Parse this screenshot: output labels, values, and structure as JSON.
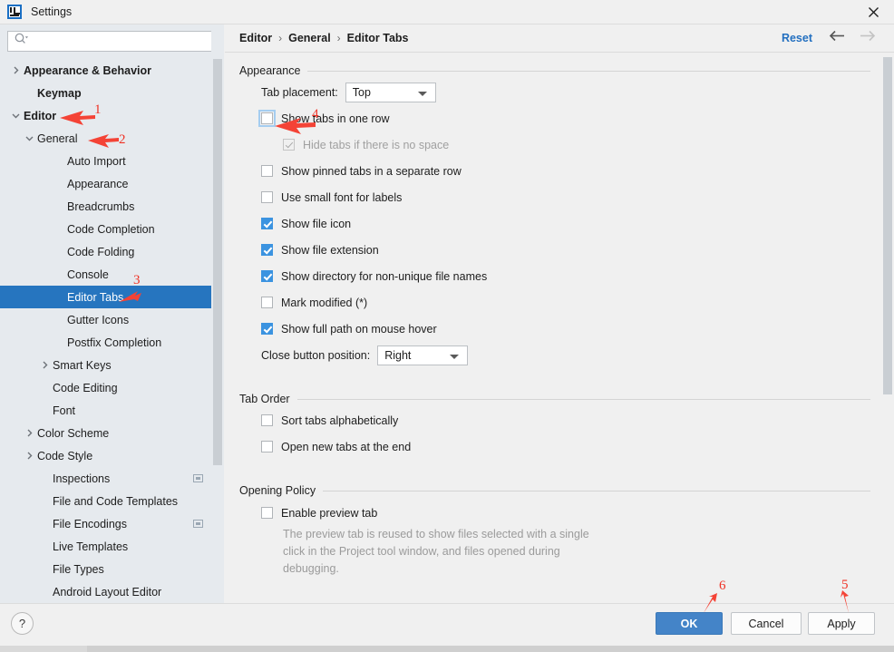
{
  "window": {
    "title": "Settings",
    "logo_icon": "intellij-idea-icon",
    "close_icon": "close-icon"
  },
  "sidebar": {
    "search": {
      "placeholder": "",
      "value": "",
      "icon": "search-icon"
    },
    "items": [
      {
        "label": "Appearance & Behavior",
        "indent": 0,
        "twisty": "right",
        "bold": true,
        "selected": false,
        "scope_icon": false
      },
      {
        "label": "Keymap",
        "indent": 1,
        "twisty": "none",
        "bold": true,
        "selected": false,
        "scope_icon": false
      },
      {
        "label": "Editor",
        "indent": 0,
        "twisty": "down",
        "bold": true,
        "selected": false,
        "scope_icon": false
      },
      {
        "label": "General",
        "indent": 1,
        "twisty": "down",
        "bold": false,
        "selected": false,
        "scope_icon": false
      },
      {
        "label": "Auto Import",
        "indent": 3,
        "twisty": "none",
        "bold": false,
        "selected": false,
        "scope_icon": false
      },
      {
        "label": "Appearance",
        "indent": 3,
        "twisty": "none",
        "bold": false,
        "selected": false,
        "scope_icon": false
      },
      {
        "label": "Breadcrumbs",
        "indent": 3,
        "twisty": "none",
        "bold": false,
        "selected": false,
        "scope_icon": false
      },
      {
        "label": "Code Completion",
        "indent": 3,
        "twisty": "none",
        "bold": false,
        "selected": false,
        "scope_icon": false
      },
      {
        "label": "Code Folding",
        "indent": 3,
        "twisty": "none",
        "bold": false,
        "selected": false,
        "scope_icon": false
      },
      {
        "label": "Console",
        "indent": 3,
        "twisty": "none",
        "bold": false,
        "selected": false,
        "scope_icon": false
      },
      {
        "label": "Editor Tabs",
        "indent": 3,
        "twisty": "none",
        "bold": false,
        "selected": true,
        "scope_icon": false
      },
      {
        "label": "Gutter Icons",
        "indent": 3,
        "twisty": "none",
        "bold": false,
        "selected": false,
        "scope_icon": false
      },
      {
        "label": "Postfix Completion",
        "indent": 3,
        "twisty": "none",
        "bold": false,
        "selected": false,
        "scope_icon": false
      },
      {
        "label": "Smart Keys",
        "indent": 2,
        "twisty": "right",
        "bold": false,
        "selected": false,
        "scope_icon": false
      },
      {
        "label": "Code Editing",
        "indent": 2,
        "twisty": "none",
        "bold": false,
        "selected": false,
        "scope_icon": false
      },
      {
        "label": "Font",
        "indent": 2,
        "twisty": "none",
        "bold": false,
        "selected": false,
        "scope_icon": false
      },
      {
        "label": "Color Scheme",
        "indent": 1,
        "twisty": "right",
        "bold": false,
        "selected": false,
        "scope_icon": false
      },
      {
        "label": "Code Style",
        "indent": 1,
        "twisty": "right",
        "bold": false,
        "selected": false,
        "scope_icon": false
      },
      {
        "label": "Inspections",
        "indent": 2,
        "twisty": "none",
        "bold": false,
        "selected": false,
        "scope_icon": true
      },
      {
        "label": "File and Code Templates",
        "indent": 2,
        "twisty": "none",
        "bold": false,
        "selected": false,
        "scope_icon": false
      },
      {
        "label": "File Encodings",
        "indent": 2,
        "twisty": "none",
        "bold": false,
        "selected": false,
        "scope_icon": true
      },
      {
        "label": "Live Templates",
        "indent": 2,
        "twisty": "none",
        "bold": false,
        "selected": false,
        "scope_icon": false
      },
      {
        "label": "File Types",
        "indent": 2,
        "twisty": "none",
        "bold": false,
        "selected": false,
        "scope_icon": false
      },
      {
        "label": "Android Layout Editor",
        "indent": 2,
        "twisty": "none",
        "bold": false,
        "selected": false,
        "scope_icon": false
      }
    ]
  },
  "header": {
    "breadcrumb": [
      "Editor",
      "General",
      "Editor Tabs"
    ],
    "separator": "›",
    "reset_label": "Reset",
    "back_icon": "arrow-left-icon",
    "forward_icon": "arrow-right-icon"
  },
  "sections": {
    "appearance": {
      "title": "Appearance",
      "tab_placement_label": "Tab placement:",
      "tab_placement_value": "Top",
      "close_button_label": "Close button position:",
      "close_button_value": "Right",
      "checkboxes": [
        {
          "label": "Show tabs in one row",
          "checked": false,
          "disabled": false,
          "indent": 1,
          "focused": true
        },
        {
          "label": "Hide tabs if there is no space",
          "checked": true,
          "disabled": true,
          "indent": 2,
          "focused": false
        },
        {
          "label": "Show pinned tabs in a separate row",
          "checked": false,
          "disabled": false,
          "indent": 1,
          "focused": false
        },
        {
          "label": "Use small font for labels",
          "checked": false,
          "disabled": false,
          "indent": 1,
          "focused": false
        },
        {
          "label": "Show file icon",
          "checked": true,
          "disabled": false,
          "indent": 1,
          "focused": false
        },
        {
          "label": "Show file extension",
          "checked": true,
          "disabled": false,
          "indent": 1,
          "focused": false
        },
        {
          "label": "Show directory for non-unique file names",
          "checked": true,
          "disabled": false,
          "indent": 1,
          "focused": false
        },
        {
          "label": "Mark modified (*)",
          "checked": false,
          "disabled": false,
          "indent": 1,
          "focused": false
        },
        {
          "label": "Show full path on mouse hover",
          "checked": true,
          "disabled": false,
          "indent": 1,
          "focused": false
        }
      ]
    },
    "tab_order": {
      "title": "Tab Order",
      "checkboxes": [
        {
          "label": "Sort tabs alphabetically",
          "checked": false
        },
        {
          "label": "Open new tabs at the end",
          "checked": false
        }
      ]
    },
    "opening_policy": {
      "title": "Opening Policy",
      "checkbox": {
        "label": "Enable preview tab",
        "checked": false
      },
      "description": "The preview tab is reused to show files selected with a single click in the Project tool window, and files opened during debugging."
    }
  },
  "footer": {
    "help_label": "?",
    "ok_label": "OK",
    "cancel_label": "Cancel",
    "apply_label": "Apply"
  },
  "annotations": [
    {
      "number": "1",
      "target": "sidebar-item-editor"
    },
    {
      "number": "2",
      "target": "sidebar-item-general"
    },
    {
      "number": "3",
      "target": "sidebar-item-editor-tabs"
    },
    {
      "number": "4",
      "target": "show-tabs-in-one-row-checkbox"
    },
    {
      "number": "5",
      "target": "apply-button"
    },
    {
      "number": "6",
      "target": "ok-button"
    }
  ],
  "colors": {
    "accent": "#2675bf",
    "link": "#2470c0",
    "checkbox_checked": "#3b93e0",
    "primary_button": "#4484c8",
    "annotation": "#ef3124",
    "sidebar_bg": "#e6eaee",
    "panel_bg": "#f0f0f0"
  }
}
